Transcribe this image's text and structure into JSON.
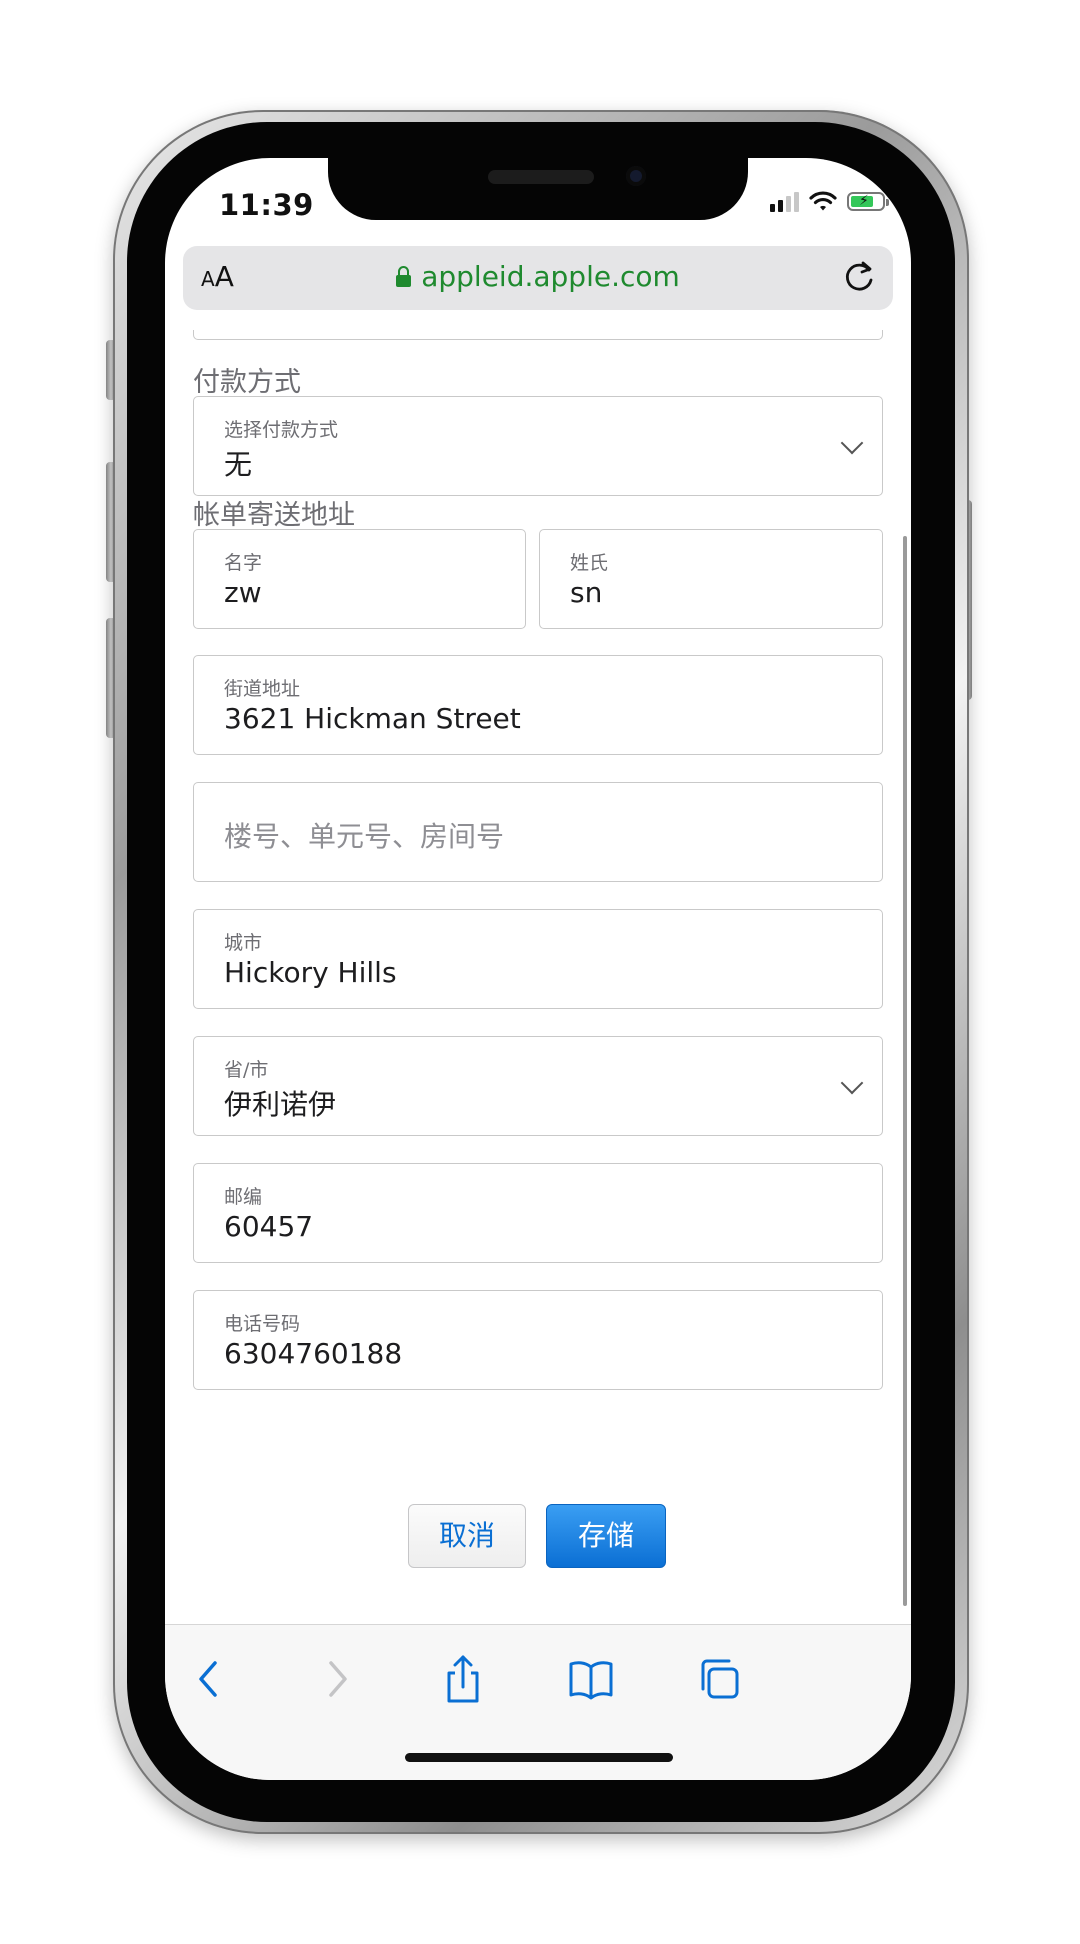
{
  "status_bar": {
    "time": "11:39"
  },
  "url_bar": {
    "text_size_small": "A",
    "text_size_large": "A",
    "domain": "appleid.apple.com"
  },
  "payment": {
    "section_title": "付款方式",
    "method_label": "选择付款方式",
    "method_value": "无"
  },
  "billing": {
    "section_title": "帐单寄送地址",
    "first_name_label": "名字",
    "first_name_value": "zw",
    "last_name_label": "姓氏",
    "last_name_value": "sn",
    "street_label": "街道地址",
    "street_value": "3621 Hickman Street",
    "unit_placeholder": "楼号、单元号、房间号",
    "city_label": "城市",
    "city_value": "Hickory Hills",
    "state_label": "省/市",
    "state_value": "伊利诺伊",
    "zip_label": "邮编",
    "zip_value": "60457",
    "phone_label": "电话号码",
    "phone_value": "6304760188"
  },
  "actions": {
    "cancel": "取消",
    "save": "存储"
  },
  "toolbar_icons": [
    "back-icon",
    "forward-icon",
    "share-icon",
    "bookmarks-icon",
    "tabs-icon"
  ],
  "colors": {
    "url_green": "#1f8a2f",
    "accent_blue": "#0a6fd3",
    "battery_green": "#34c759"
  }
}
